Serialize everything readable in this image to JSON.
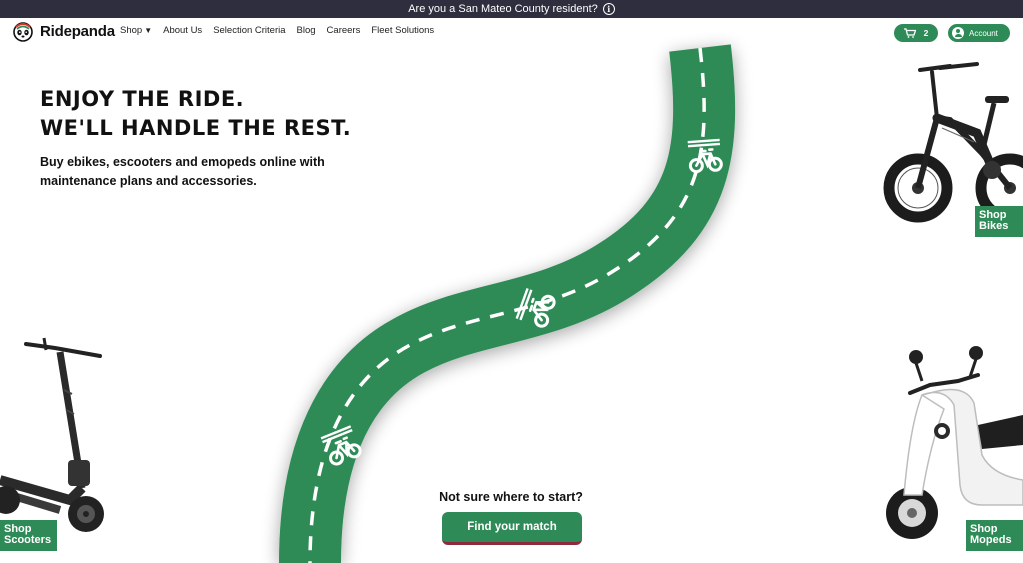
{
  "announcement": {
    "text": "Are you a San Mateo County resident?",
    "icon": "info-icon"
  },
  "nav": {
    "logo_text": "Ridepanda",
    "links": [
      "Shop",
      "About Us",
      "Selection Criteria",
      "Blog",
      "Careers",
      "Fleet Solutions"
    ],
    "cart_count": "2",
    "account_label": "Account"
  },
  "hero": {
    "title_line1": "ENJOY THE RIDE.",
    "title_line2": "WE'LL HANDLE THE REST.",
    "subtitle": "Buy ebikes, escooters and emopeds online with maintenance plans and accessories."
  },
  "cta": {
    "question": "Not sure where to start?",
    "button": "Find your match"
  },
  "shop_tags": {
    "bikes_line1": "Shop",
    "bikes_line2": "Bikes",
    "scooters_line1": "Shop",
    "scooters_line2": "Scooters",
    "mopeds_line1": "Shop",
    "mopeds_line2": "Mopeds"
  },
  "colors": {
    "brand_green": "#2e8b57",
    "topbar_bg": "#2e2e3e",
    "cta_underline": "#8e2a3e"
  }
}
